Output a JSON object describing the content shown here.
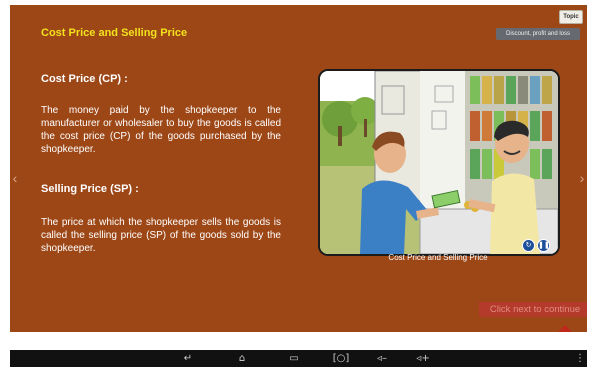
{
  "slide": {
    "title": "Cost Price and Selling Price",
    "topic_button": "Topic",
    "topic_name": "Discount, profit and loss"
  },
  "content": {
    "cp_heading": "Cost Price (CP) :",
    "cp_text": "The money paid by the shopkeeper to the manufacturer or wholesaler to buy the goods is called the cost price (CP) of the goods purchased by the shopkeeper.",
    "sp_heading": "Selling Price (SP) :",
    "sp_text": "The price at which the shopkeeper sells the goods is called the selling price (SP) of the goods sold by the shopkeeper."
  },
  "illustration": {
    "caption": "Cost Price and Selling Price"
  },
  "footer": {
    "next_hint": "Click next to continue"
  },
  "colors": {
    "background": "#9d4717",
    "title": "#f2e21e",
    "next": "#c0281c"
  },
  "icons": {
    "replay": "replay-icon",
    "pause": "pause-icon",
    "prev": "chevron-left-icon",
    "next": "chevron-right-icon",
    "nav_back": "back-icon",
    "nav_home": "home-icon",
    "nav_recents": "recents-icon",
    "nav_screenshot": "screenshot-icon",
    "nav_vol_down": "volume-down-icon",
    "nav_vol_up": "volume-up-icon",
    "nav_menu": "menu-dots-icon"
  }
}
